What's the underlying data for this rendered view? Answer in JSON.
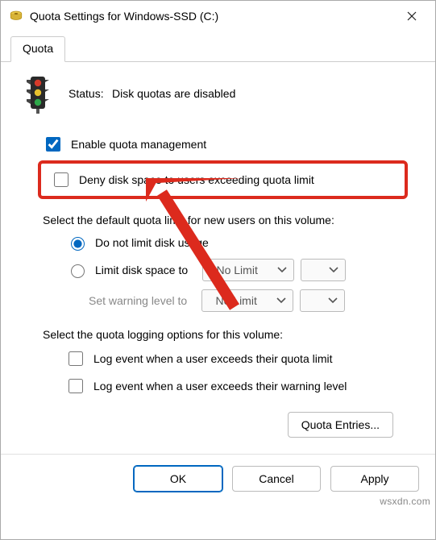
{
  "window": {
    "title": "Quota Settings for Windows-SSD (C:)"
  },
  "tab": {
    "label": "Quota"
  },
  "status": {
    "label": "Status:",
    "value": "Disk quotas are disabled"
  },
  "checks": {
    "enable": "Enable quota management",
    "deny": "Deny disk space to users exceeding quota limit"
  },
  "defaults": {
    "header": "Select the default quota limit for new users on this volume:",
    "r1": "Do not limit disk usage",
    "r2": "Limit disk space to",
    "r3": "Set warning level to",
    "noLimit1": "No Limit",
    "noLimit2": "No Limit"
  },
  "logging": {
    "header": "Select the quota logging options for this volume:",
    "c1": "Log event when a user exceeds their quota limit",
    "c2": "Log event when a user exceeds their warning level"
  },
  "buttons": {
    "entries": "Quota Entries...",
    "ok": "OK",
    "cancel": "Cancel",
    "apply": "Apply"
  },
  "watermark": "wsxdn.com"
}
